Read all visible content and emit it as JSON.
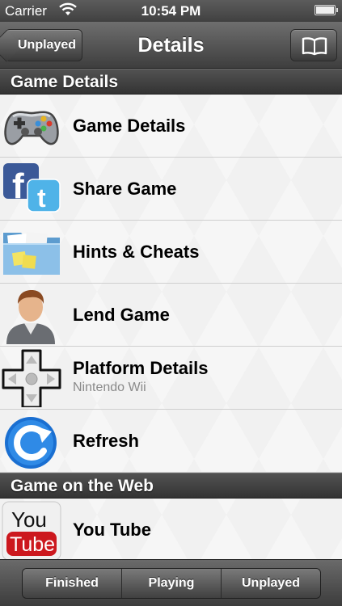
{
  "status_bar": {
    "carrier": "Carrier",
    "time": "10:54 PM"
  },
  "nav": {
    "title": "Details",
    "back_label": "Unplayed",
    "right_icon": "book-icon"
  },
  "sections": [
    {
      "title": "Game Details",
      "rows": [
        {
          "label": "Game Details",
          "icon": "gamepad-icon"
        },
        {
          "label": "Share Game",
          "icon": "facebook-twitter-icon"
        },
        {
          "label": "Hints & Cheats",
          "icon": "folder-icon"
        },
        {
          "label": "Lend Game",
          "icon": "person-icon"
        },
        {
          "label": "Platform Details",
          "sublabel": "Nintendo Wii",
          "icon": "dpad-icon"
        },
        {
          "label": "Refresh",
          "icon": "refresh-icon"
        }
      ]
    },
    {
      "title": "Game on the Web",
      "rows": [
        {
          "label": "You Tube",
          "icon": "youtube-icon"
        }
      ]
    }
  ],
  "youtube_logo": {
    "top": "You",
    "bottom": "Tube"
  },
  "toolbar": {
    "segments": [
      "Finished",
      "Playing",
      "Unplayed"
    ]
  },
  "colors": {
    "bar_dark": "#3e3e3e",
    "section_header": "#404040",
    "sublabel": "#8a8a8a",
    "facebook_blue": "#3b5998",
    "twitter_blue": "#4fb3e8",
    "youtube_red": "#cc181e"
  }
}
